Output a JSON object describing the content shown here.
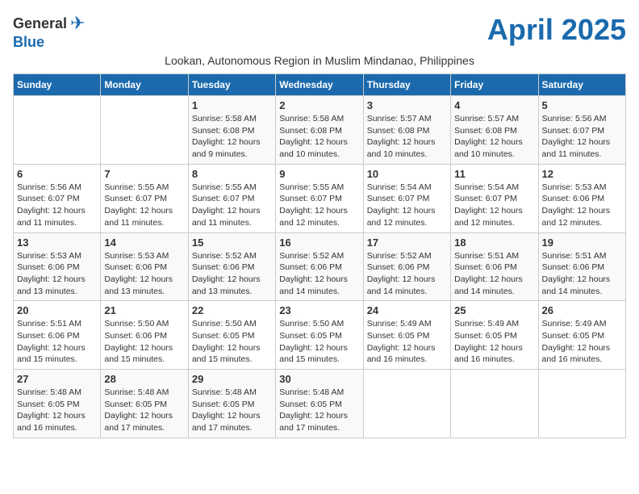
{
  "header": {
    "logo_general": "General",
    "logo_blue": "Blue",
    "month_title": "April 2025",
    "subtitle": "Lookan, Autonomous Region in Muslim Mindanao, Philippines"
  },
  "days_of_week": [
    "Sunday",
    "Monday",
    "Tuesday",
    "Wednesday",
    "Thursday",
    "Friday",
    "Saturday"
  ],
  "weeks": [
    [
      {
        "num": "",
        "info": ""
      },
      {
        "num": "",
        "info": ""
      },
      {
        "num": "1",
        "info": "Sunrise: 5:58 AM\nSunset: 6:08 PM\nDaylight: 12 hours and 9 minutes."
      },
      {
        "num": "2",
        "info": "Sunrise: 5:58 AM\nSunset: 6:08 PM\nDaylight: 12 hours and 10 minutes."
      },
      {
        "num": "3",
        "info": "Sunrise: 5:57 AM\nSunset: 6:08 PM\nDaylight: 12 hours and 10 minutes."
      },
      {
        "num": "4",
        "info": "Sunrise: 5:57 AM\nSunset: 6:08 PM\nDaylight: 12 hours and 10 minutes."
      },
      {
        "num": "5",
        "info": "Sunrise: 5:56 AM\nSunset: 6:07 PM\nDaylight: 12 hours and 11 minutes."
      }
    ],
    [
      {
        "num": "6",
        "info": "Sunrise: 5:56 AM\nSunset: 6:07 PM\nDaylight: 12 hours and 11 minutes."
      },
      {
        "num": "7",
        "info": "Sunrise: 5:55 AM\nSunset: 6:07 PM\nDaylight: 12 hours and 11 minutes."
      },
      {
        "num": "8",
        "info": "Sunrise: 5:55 AM\nSunset: 6:07 PM\nDaylight: 12 hours and 11 minutes."
      },
      {
        "num": "9",
        "info": "Sunrise: 5:55 AM\nSunset: 6:07 PM\nDaylight: 12 hours and 12 minutes."
      },
      {
        "num": "10",
        "info": "Sunrise: 5:54 AM\nSunset: 6:07 PM\nDaylight: 12 hours and 12 minutes."
      },
      {
        "num": "11",
        "info": "Sunrise: 5:54 AM\nSunset: 6:07 PM\nDaylight: 12 hours and 12 minutes."
      },
      {
        "num": "12",
        "info": "Sunrise: 5:53 AM\nSunset: 6:06 PM\nDaylight: 12 hours and 12 minutes."
      }
    ],
    [
      {
        "num": "13",
        "info": "Sunrise: 5:53 AM\nSunset: 6:06 PM\nDaylight: 12 hours and 13 minutes."
      },
      {
        "num": "14",
        "info": "Sunrise: 5:53 AM\nSunset: 6:06 PM\nDaylight: 12 hours and 13 minutes."
      },
      {
        "num": "15",
        "info": "Sunrise: 5:52 AM\nSunset: 6:06 PM\nDaylight: 12 hours and 13 minutes."
      },
      {
        "num": "16",
        "info": "Sunrise: 5:52 AM\nSunset: 6:06 PM\nDaylight: 12 hours and 14 minutes."
      },
      {
        "num": "17",
        "info": "Sunrise: 5:52 AM\nSunset: 6:06 PM\nDaylight: 12 hours and 14 minutes."
      },
      {
        "num": "18",
        "info": "Sunrise: 5:51 AM\nSunset: 6:06 PM\nDaylight: 12 hours and 14 minutes."
      },
      {
        "num": "19",
        "info": "Sunrise: 5:51 AM\nSunset: 6:06 PM\nDaylight: 12 hours and 14 minutes."
      }
    ],
    [
      {
        "num": "20",
        "info": "Sunrise: 5:51 AM\nSunset: 6:06 PM\nDaylight: 12 hours and 15 minutes."
      },
      {
        "num": "21",
        "info": "Sunrise: 5:50 AM\nSunset: 6:06 PM\nDaylight: 12 hours and 15 minutes."
      },
      {
        "num": "22",
        "info": "Sunrise: 5:50 AM\nSunset: 6:05 PM\nDaylight: 12 hours and 15 minutes."
      },
      {
        "num": "23",
        "info": "Sunrise: 5:50 AM\nSunset: 6:05 PM\nDaylight: 12 hours and 15 minutes."
      },
      {
        "num": "24",
        "info": "Sunrise: 5:49 AM\nSunset: 6:05 PM\nDaylight: 12 hours and 16 minutes."
      },
      {
        "num": "25",
        "info": "Sunrise: 5:49 AM\nSunset: 6:05 PM\nDaylight: 12 hours and 16 minutes."
      },
      {
        "num": "26",
        "info": "Sunrise: 5:49 AM\nSunset: 6:05 PM\nDaylight: 12 hours and 16 minutes."
      }
    ],
    [
      {
        "num": "27",
        "info": "Sunrise: 5:48 AM\nSunset: 6:05 PM\nDaylight: 12 hours and 16 minutes."
      },
      {
        "num": "28",
        "info": "Sunrise: 5:48 AM\nSunset: 6:05 PM\nDaylight: 12 hours and 17 minutes."
      },
      {
        "num": "29",
        "info": "Sunrise: 5:48 AM\nSunset: 6:05 PM\nDaylight: 12 hours and 17 minutes."
      },
      {
        "num": "30",
        "info": "Sunrise: 5:48 AM\nSunset: 6:05 PM\nDaylight: 12 hours and 17 minutes."
      },
      {
        "num": "",
        "info": ""
      },
      {
        "num": "",
        "info": ""
      },
      {
        "num": "",
        "info": ""
      }
    ]
  ]
}
